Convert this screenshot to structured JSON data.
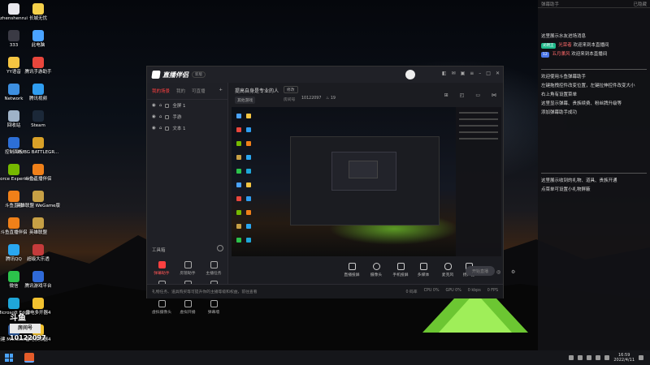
{
  "desktop": {
    "icons": [
      {
        "label": "zhenshenrui",
        "color": "#e8e8ee"
      },
      {
        "label": "长城无忧",
        "color": "#f5d04a"
      },
      {
        "label": "333",
        "color": "#3a3a44"
      },
      {
        "label": "此电脑",
        "color": "#4aa3ff"
      },
      {
        "label": "YY语音",
        "color": "#f5c542"
      },
      {
        "label": "腾讯手游助手",
        "color": "#e8463c"
      },
      {
        "label": "Network",
        "color": "#3d8fe0"
      },
      {
        "label": "腾讯视频",
        "color": "#2f9df0"
      },
      {
        "label": "回收站",
        "color": "#9fb3c8"
      },
      {
        "label": "Steam",
        "color": "#1b2838"
      },
      {
        "label": "控制面板",
        "color": "#2d6fd6"
      },
      {
        "label": "PUBG BATTLEGR...",
        "color": "#d9a128"
      },
      {
        "label": "GeForce Experience",
        "color": "#76b900"
      },
      {
        "label": "斗鱼直播伴侣",
        "color": "#f08019"
      },
      {
        "label": "斗鱼直播",
        "color": "#f08019"
      },
      {
        "label": "英雄联盟 WeGame版",
        "color": "#c7a045"
      },
      {
        "label": "斗鱼直播伴侣",
        "color": "#f08019"
      },
      {
        "label": "英雄联盟",
        "color": "#c7a045"
      },
      {
        "label": "腾讯QQ",
        "color": "#2aa7f0"
      },
      {
        "label": "超级大乐透",
        "color": "#c43b3b"
      },
      {
        "label": "微信",
        "color": "#2cc24b"
      },
      {
        "label": "腾讯游戏平台",
        "color": "#2f6ad8"
      },
      {
        "label": "Microsoft Edge",
        "color": "#1fa6d9"
      },
      {
        "label": "雷电多开器4",
        "color": "#f2c230"
      },
      {
        "label": "新建 Microsoft...",
        "color": "#2b5797"
      },
      {
        "label": "雷电模拟器4",
        "color": "#f2c230"
      }
    ]
  },
  "chat": {
    "header_left": "弹幕助手",
    "header_right": "已隐藏",
    "lines": [
      {
        "text": "这里展示水友进场消息",
        "badge": "",
        "badge_color": ""
      },
      {
        "text": "欢迎来到本直播间",
        "badge": "光明王",
        "badge_color": "#1fb98a",
        "user": "光荣者"
      },
      {
        "text": "欢迎来到本直播间",
        "badge": "12",
        "badge_color": "#4a76e8",
        "user": "五月薰风"
      },
      {
        "text": "欢迎使用斗鱼弹幕助手",
        "badge": "",
        "badge_color": ""
      },
      {
        "text": "左键拖拽控件改变位置，左键拉伸控件改变大小",
        "badge": "",
        "badge_color": ""
      },
      {
        "text": "右上角有设置菜单",
        "badge": "",
        "badge_color": ""
      },
      {
        "text": "这里显示弹幕、贵族续费、粉丝牌升级等",
        "badge": "",
        "badge_color": ""
      },
      {
        "text": "添加弹幕助手成功",
        "badge": "",
        "badge_color": ""
      },
      {
        "text": "这里展示收到的礼物、道具、贵族开通",
        "badge": "",
        "badge_color": ""
      },
      {
        "text": "点菜单可设置小礼物屏蔽",
        "badge": "",
        "badge_color": ""
      }
    ]
  },
  "app": {
    "logo_text": "直播伴侣",
    "version_pill": "新版",
    "tabs": [
      "我的场景",
      "我的",
      "可直播"
    ],
    "active_tab": 0,
    "scenes": [
      "全屏 1",
      "手游",
      "文本 1"
    ],
    "tools_header": "工具箱",
    "tools": [
      {
        "label": "弹幕助手",
        "red": true
      },
      {
        "label": "房管助手",
        "red": false
      },
      {
        "label": "主播任务",
        "red": false
      },
      {
        "label": "视频连麦",
        "red": false
      },
      {
        "label": "多人连麦",
        "red": false
      },
      {
        "label": "帐号管理",
        "red": false
      },
      {
        "label": "虚拟摄像头",
        "red": false
      },
      {
        "label": "虚拟开播",
        "red": false
      },
      {
        "label": "弹幕墙",
        "red": false
      }
    ],
    "room_title": "提高自身是专业的人",
    "edit_label": "修改",
    "category": "其他游戏",
    "room_no_label": "房间号",
    "room_no": "10122097",
    "fans_count": "19",
    "bottom": [
      {
        "label": "直播投屏"
      },
      {
        "label": "摄像头"
      },
      {
        "label": "手机投屏"
      },
      {
        "label": "多媒体"
      },
      {
        "label": "麦克风"
      },
      {
        "label": "扬声器"
      }
    ],
    "start_button": "开始直播",
    "status_tip": "礼物任务、道具购买等可提升你的主播等级和权益，前往查看",
    "status_right": [
      "0 码率",
      "CPU 0%",
      "GPU 0%",
      "0 kbps",
      "0 FPS"
    ]
  },
  "watermark": {
    "label": "房间号",
    "number": "10122097"
  },
  "taskbar": {
    "time": "16:59",
    "date": "2022/4/11"
  },
  "colors": {
    "accent": "#ff4040",
    "tent_glow": "#8cf03c"
  }
}
